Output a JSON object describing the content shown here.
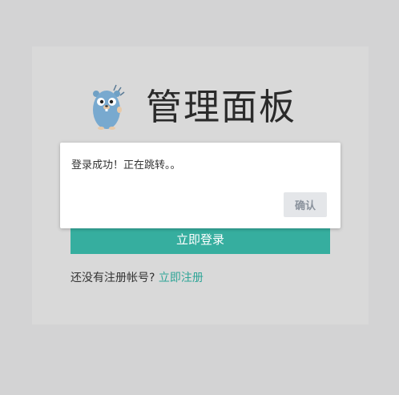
{
  "brand": {
    "title": "管理面板",
    "logo": "gopher-mascot"
  },
  "modal": {
    "message": "登录成功！正在跳转。。",
    "confirm_label": "确认"
  },
  "form": {
    "login_label": "立即登录"
  },
  "footer": {
    "prompt": "还没有注册帐号?",
    "register_link": "立即注册"
  },
  "colors": {
    "accent": "#36ae9f",
    "link": "#2fa597",
    "background": "#d3d3d4"
  }
}
